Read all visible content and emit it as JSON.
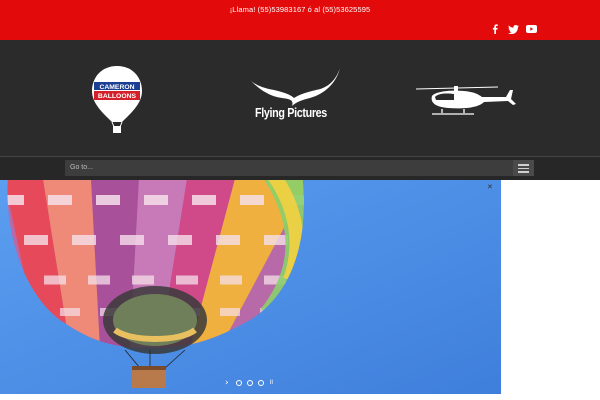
{
  "topbar": {
    "phone_text": "¡Llama! (55)53983167 ó al (55)53625595",
    "background": "#e20a0a",
    "social_icons": [
      "facebook-icon",
      "twitter-icon",
      "youtube-icon"
    ]
  },
  "header": {
    "logo_left": {
      "text_line1": "CAMERON",
      "text_line2": "BALLOONS"
    },
    "logo_center_text": "Flying Pictures",
    "logo_right": "helicopter"
  },
  "nav": {
    "goto_label": "Go to...",
    "menu_icon": "hamburger-icon"
  },
  "slider": {
    "image": "hot-air-balloon",
    "controls": {
      "next_glyph": "›",
      "pause_glyph": "॥",
      "slides_total": 3,
      "close_glyph": "✕"
    }
  },
  "colors": {
    "brand_red": "#e20a0a",
    "header_dark": "#2b2b2b",
    "sky_blue": "#4a8ee8"
  }
}
